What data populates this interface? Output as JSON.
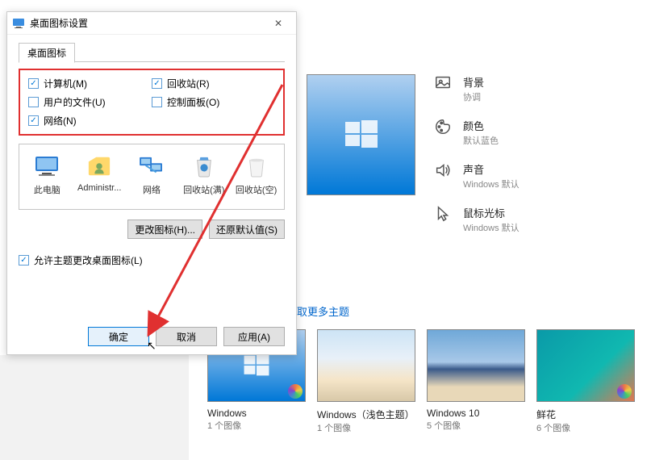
{
  "dialog": {
    "title": "桌面图标设置",
    "tab": "桌面图标",
    "checkboxes": {
      "computer": {
        "label": "计算机(M)",
        "checked": true
      },
      "recycle": {
        "label": "回收站(R)",
        "checked": true
      },
      "userfiles": {
        "label": "用户的文件(U)",
        "checked": false
      },
      "control": {
        "label": "控制面板(O)",
        "checked": false
      },
      "network": {
        "label": "网络(N)",
        "checked": true
      }
    },
    "icons": {
      "pc": "此电脑",
      "admin": "Administr...",
      "net": "网络",
      "binfull": "回收站(满)",
      "binempty": "回收站(空)"
    },
    "btn_change": "更改图标(H)...",
    "btn_restore": "还原默认值(S)",
    "allow_theme": {
      "label": "允许主题更改桌面图标(L)",
      "checked": true
    },
    "btn_ok": "确定",
    "btn_cancel": "取消",
    "btn_apply": "应用(A)"
  },
  "settings": {
    "bg": {
      "title": "背景",
      "sub": "协调"
    },
    "color": {
      "title": "颜色",
      "sub": "默认蓝色"
    },
    "sound": {
      "title": "声音",
      "sub": "Windows 默认"
    },
    "cursor": {
      "title": "鼠标光标",
      "sub": "Windows 默认"
    }
  },
  "more_link": "取更多主题",
  "themes": [
    {
      "name": "Windows",
      "count": "1 个图像",
      "style": "win-blue",
      "badge": true
    },
    {
      "name": "Windows（浅色主题）",
      "count": "1 个图像",
      "style": "win-light",
      "badge": false
    },
    {
      "name": "Windows 10",
      "count": "5 个图像",
      "style": "beach",
      "badge": false
    },
    {
      "name": "鲜花",
      "count": "6 个图像",
      "style": "flower",
      "badge": true
    }
  ]
}
